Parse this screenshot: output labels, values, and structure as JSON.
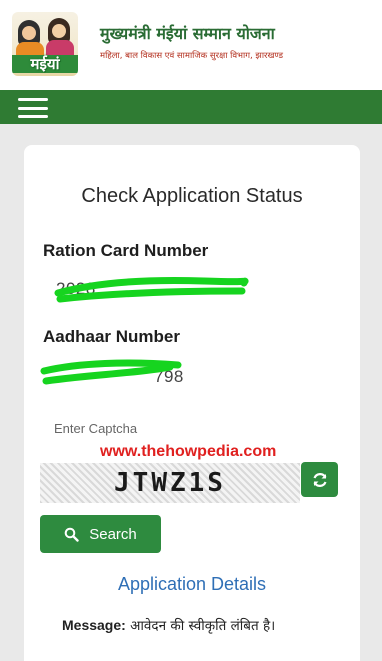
{
  "header": {
    "logo_text": "मईयां",
    "title": "मुख्यमंत्री मंईयां सम्मान योजना",
    "subtitle": "महिला, बाल विकास एवं सामाजिक सुरक्षा विभाग, झारखण्ड"
  },
  "nav": {
    "menu_icon": "hamburger-menu-icon"
  },
  "form": {
    "title": "Check Application Status",
    "ration_label": "Ration Card Number",
    "ration_value": "2028",
    "aadhaar_label": "Aadhaar Number",
    "aadhaar_value": "798",
    "captcha_placeholder": "Enter Captcha",
    "captcha_text": "JTWZ1S",
    "refresh_icon": "refresh-icon",
    "search_label": "Search",
    "search_icon": "search-icon"
  },
  "watermark": "www.thehowpedia.com",
  "details": {
    "heading": "Application Details",
    "message_label": "Message:",
    "message_text": " आवेदन की स्वीकृति लंबित है।"
  },
  "colors": {
    "brand_green": "#2f7b33",
    "button_green": "#2e8b3f",
    "scribble_green": "#16d41f",
    "link_blue": "#2f6fb6",
    "watermark_red": "#e0201f"
  }
}
